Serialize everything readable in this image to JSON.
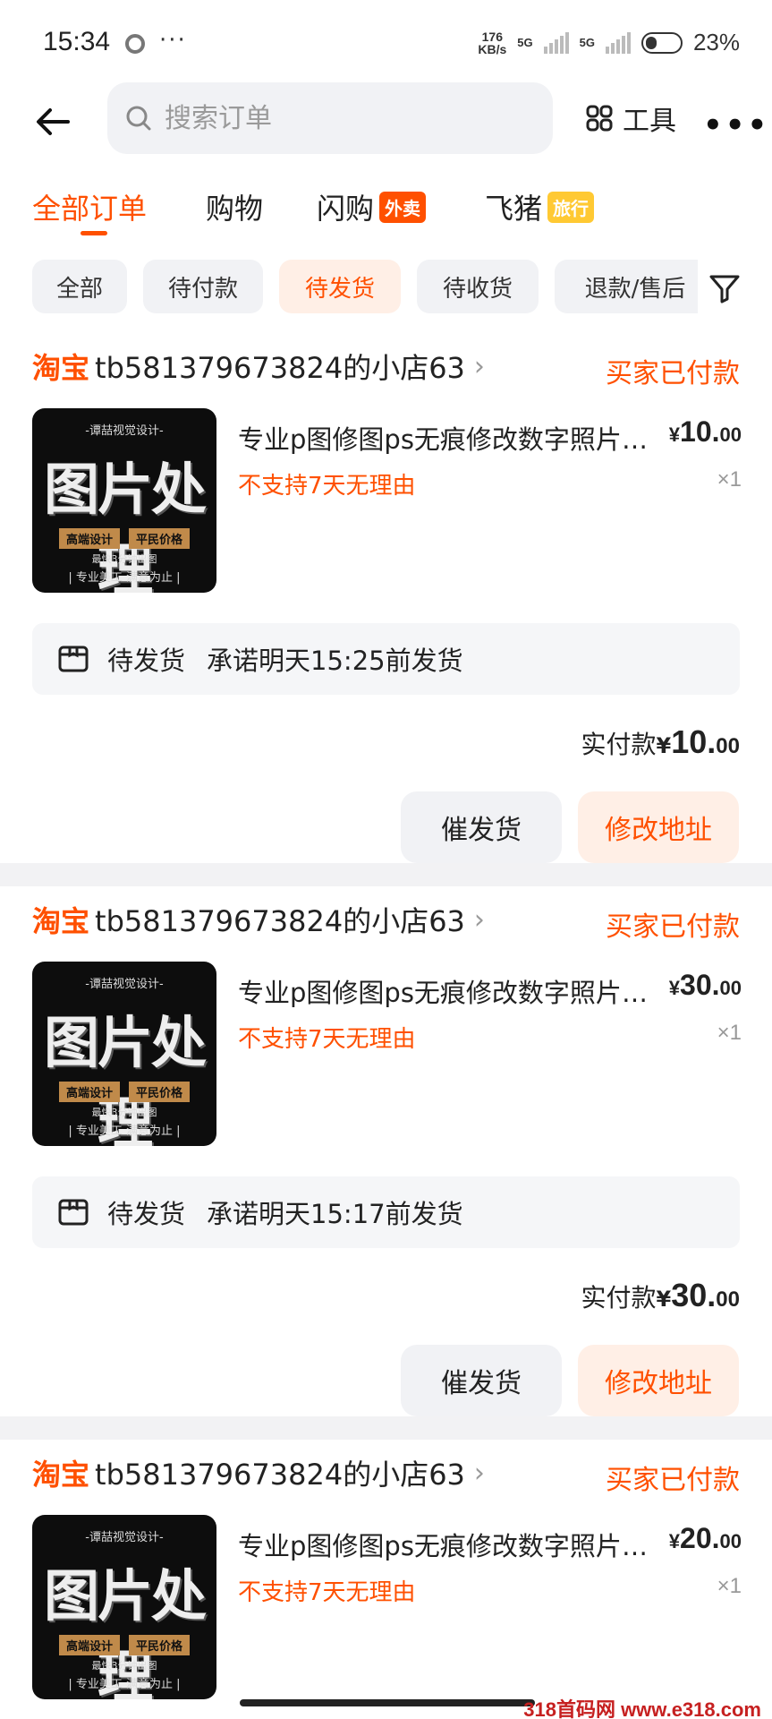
{
  "status_bar": {
    "time": "15:34",
    "dots": "···",
    "speed_value": "176",
    "speed_unit": "KB/s",
    "net1": "5G",
    "net2": "5G",
    "battery": "23%"
  },
  "header": {
    "search_placeholder": "搜索订单",
    "tools_label": "工具",
    "more_label": "•••"
  },
  "main_tabs": [
    {
      "label": "全部订单",
      "active": true
    },
    {
      "label": "购物"
    },
    {
      "label": "闪购",
      "badge": "外卖"
    },
    {
      "label": "飞猪",
      "badge": "旅行"
    }
  ],
  "filters": [
    {
      "label": "全部"
    },
    {
      "label": "待付款"
    },
    {
      "label": "待发货",
      "active": true
    },
    {
      "label": "待收货"
    },
    {
      "label": "退款/售后"
    }
  ],
  "thumbnail": {
    "top": "-谭喆视觉设计-",
    "big": "图片处理",
    "tag1": "高端设计",
    "tag2": "平民价格",
    "line1": "最快3分钟出图",
    "line2": "| 专业美工  满意为止 |"
  },
  "orders": [
    {
      "platform": "淘宝",
      "shop": "tb581379673824的小店63",
      "status": "买家已付款",
      "title": "专业p图修图ps无痕修改数字照片图片处理",
      "note": "不支持7天无理由",
      "price_int": "10.",
      "price_dec": "00",
      "qty": "×1",
      "ship_label": "待发货",
      "ship_promise": "承诺明天15:25前发货",
      "paid_label": "实付款",
      "paid_int": "10.",
      "paid_dec": "00",
      "btn_urge": "催发货",
      "btn_addr": "修改地址"
    },
    {
      "platform": "淘宝",
      "shop": "tb581379673824的小店63",
      "status": "买家已付款",
      "title": "专业p图修图ps无痕修改数字照片图片处理",
      "note": "不支持7天无理由",
      "price_int": "30.",
      "price_dec": "00",
      "qty": "×1",
      "ship_label": "待发货",
      "ship_promise": "承诺明天15:17前发货",
      "paid_label": "实付款",
      "paid_int": "30.",
      "paid_dec": "00",
      "btn_urge": "催发货",
      "btn_addr": "修改地址"
    },
    {
      "platform": "淘宝",
      "shop": "tb581379673824的小店63",
      "status": "买家已付款",
      "title": "专业p图修图ps无痕修改数字照片图片处理",
      "note": "不支持7天无理由",
      "price_int": "20.",
      "price_dec": "00",
      "qty": "×1"
    }
  ],
  "currency": "¥",
  "watermark": "318首码网 www.e318.com",
  "colors": {
    "accent": "#ff5000",
    "chip_active_bg": "#ffefe6",
    "page_bg": "#f2f2f4"
  }
}
